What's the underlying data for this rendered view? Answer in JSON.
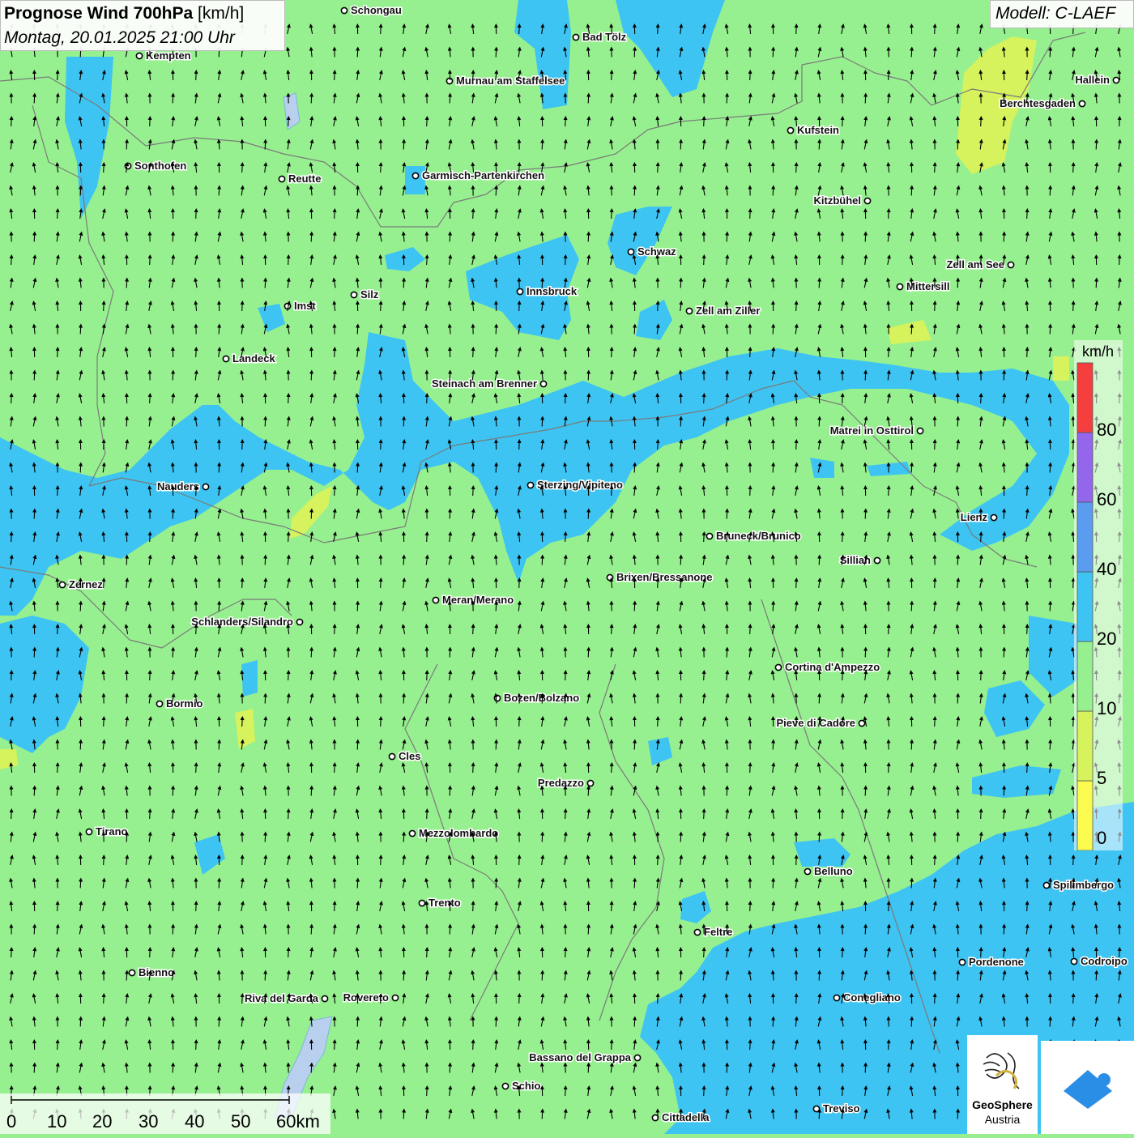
{
  "header": {
    "title_bold": "Prognose Wind 700hPa",
    "title_unit": "[km/h]",
    "datetime": "Montag, 20.01.2025 21:00 Uhr"
  },
  "model": "Modell: C-LAEF",
  "legend": {
    "unit": "km/h",
    "steps": [
      {
        "label": "0",
        "color": "#fbfb4f"
      },
      {
        "label": "5",
        "color": "#d6f25c"
      },
      {
        "label": "10",
        "color": "#97f08f"
      },
      {
        "label": "20",
        "color": "#3ec4f2"
      },
      {
        "label": "40",
        "color": "#5a9cf0"
      },
      {
        "label": "60",
        "color": "#9366ec"
      },
      {
        "label": "80",
        "color": "#f53e3e"
      }
    ]
  },
  "scale": {
    "labels": [
      "0",
      "10",
      "20",
      "30",
      "40",
      "50",
      "60km"
    ]
  },
  "logo": {
    "name": "GeoSphere",
    "subtitle": "Austria",
    "icon": "geosphere-logo-icon"
  },
  "app_icon": "app-wind-icon",
  "cities": [
    {
      "name": "Schongau"
    },
    {
      "name": "Bad Tölz"
    },
    {
      "name": "Kempten"
    },
    {
      "name": "Murnau am Staffelsee"
    },
    {
      "name": "Hallein"
    },
    {
      "name": "Berchtesgaden"
    },
    {
      "name": "Kufstein"
    },
    {
      "name": "Sonthofen"
    },
    {
      "name": "Reutte"
    },
    {
      "name": "Garmisch-Partenkirchen"
    },
    {
      "name": "Kitzbühel"
    },
    {
      "name": "Schwaz"
    },
    {
      "name": "Zell am See"
    },
    {
      "name": "Innsbruck"
    },
    {
      "name": "Mittersill"
    },
    {
      "name": "Imst"
    },
    {
      "name": "Silz"
    },
    {
      "name": "Zell am Ziller"
    },
    {
      "name": "Landeck"
    },
    {
      "name": "Steinach am Brenner"
    },
    {
      "name": "Matrei in Osttirol"
    },
    {
      "name": "Nauders"
    },
    {
      "name": "Sterzing/Vipiteno"
    },
    {
      "name": "Lienz"
    },
    {
      "name": "Bruneck/Brunico"
    },
    {
      "name": "Sillian"
    },
    {
      "name": "Zernez"
    },
    {
      "name": "Brixen/Bressanone"
    },
    {
      "name": "Meran/Merano"
    },
    {
      "name": "Schlanders/Silandro"
    },
    {
      "name": "Cortina d'Ampezzo"
    },
    {
      "name": "Bormio"
    },
    {
      "name": "Bozen/Bolzano"
    },
    {
      "name": "Pieve di Cadore"
    },
    {
      "name": "Cles"
    },
    {
      "name": "Predazzo"
    },
    {
      "name": "Tirano"
    },
    {
      "name": "Mezzolombardo"
    },
    {
      "name": "Belluno"
    },
    {
      "name": "Spilimbergo"
    },
    {
      "name": "Trento"
    },
    {
      "name": "Feltre"
    },
    {
      "name": "Pordenone"
    },
    {
      "name": "Codroipo"
    },
    {
      "name": "Bienno"
    },
    {
      "name": "Riva del Garda"
    },
    {
      "name": "Rovereto"
    },
    {
      "name": "Conegliano"
    },
    {
      "name": "Bassano del Grappa"
    },
    {
      "name": "Schio"
    },
    {
      "name": "Treviso"
    },
    {
      "name": "Cittadella"
    }
  ]
}
